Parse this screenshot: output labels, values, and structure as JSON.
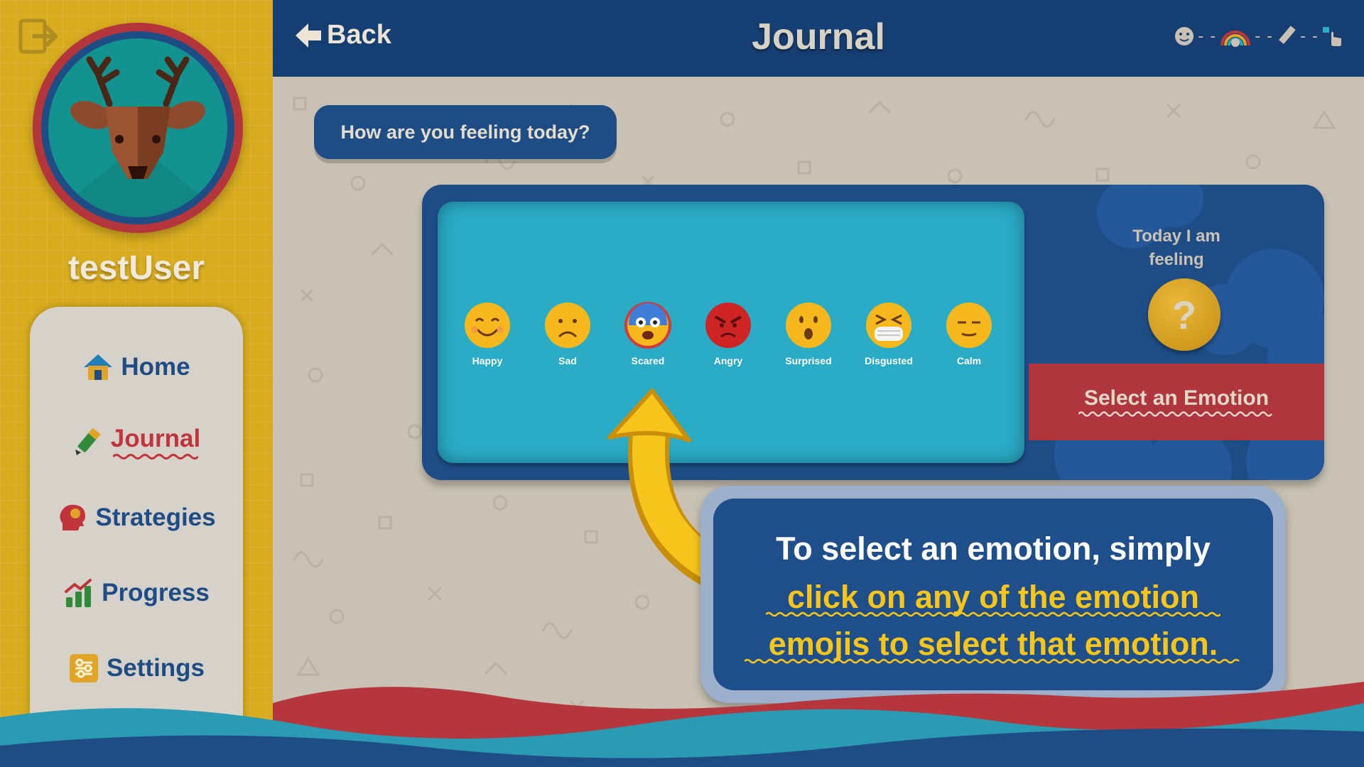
{
  "sidebar": {
    "username": "testUser",
    "nav": [
      {
        "label": "Home",
        "icon": "home-icon"
      },
      {
        "label": "Journal",
        "icon": "pencil-icon",
        "active": true
      },
      {
        "label": "Strategies",
        "icon": "head-icon"
      },
      {
        "label": "Progress",
        "icon": "chart-icon"
      },
      {
        "label": "Settings",
        "icon": "sliders-icon"
      }
    ]
  },
  "header": {
    "back_label": "Back",
    "title": "Journal"
  },
  "journal": {
    "question": "How are you feeling today?",
    "emotions": [
      {
        "label": "Happy"
      },
      {
        "label": "Sad"
      },
      {
        "label": "Scared",
        "highlighted": true
      },
      {
        "label": "Angry"
      },
      {
        "label": "Surprised"
      },
      {
        "label": "Disgusted"
      },
      {
        "label": "Calm"
      }
    ],
    "feeling_line1": "Today I am",
    "feeling_line2": "feeling",
    "placeholder_symbol": "?",
    "select_button": "Select an Emotion"
  },
  "tutorial": {
    "line1": "To select an emotion, simply",
    "line2": "click on any of the emotion",
    "line3": "emojis to select that emotion."
  },
  "colors": {
    "navy": "#153e72",
    "accent_yellow": "#d8ac1e",
    "accent_red": "#b0363e",
    "panel_teal": "#2aabc6"
  }
}
